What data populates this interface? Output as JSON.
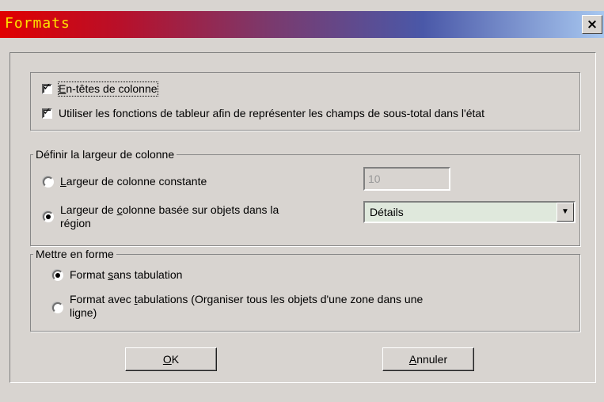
{
  "window": {
    "title": "Formats",
    "close_glyph": "×"
  },
  "group1": {
    "checkbox1_label_pre": "",
    "checkbox1_label_u": "E",
    "checkbox1_label_post": "n-têtes de colonne",
    "checkbox1_checked": true,
    "checkbox2_label": "Utiliser les fonctions de tableur afin de représenter les champs de sous-total dans l'état",
    "checkbox2_checked": true
  },
  "group_width": {
    "legend": "Définir la largeur de colonne",
    "radio1_label_u": "L",
    "radio1_label_post": "argeur de colonne constante",
    "radio1_selected": false,
    "constant_value": "10",
    "radio2_label_pre": "Largeur de ",
    "radio2_label_u": "c",
    "radio2_label_post": "olonne basée sur objets dans la",
    "radio2_label_line2": "région",
    "radio2_selected": true,
    "region_select_value": "Détails"
  },
  "group_format": {
    "legend": "Mettre en forme",
    "radio1_label_pre": "Format ",
    "radio1_label_u": "s",
    "radio1_label_post": "ans tabulation",
    "radio1_selected": true,
    "radio2_label_pre": "Format avec ",
    "radio2_label_u": "t",
    "radio2_label_post": "abulations (Organiser tous les objets d'une zone dans une",
    "radio2_label_line2": "ligne)",
    "radio2_selected": false
  },
  "buttons": {
    "ok_u": "O",
    "ok_post": "K",
    "cancel_u": "A",
    "cancel_post": "nnuler"
  },
  "colors": {
    "title_text": "#ffe400",
    "dialog_bg": "#d8d4d0",
    "combo_bg": "#dfe8dc"
  }
}
